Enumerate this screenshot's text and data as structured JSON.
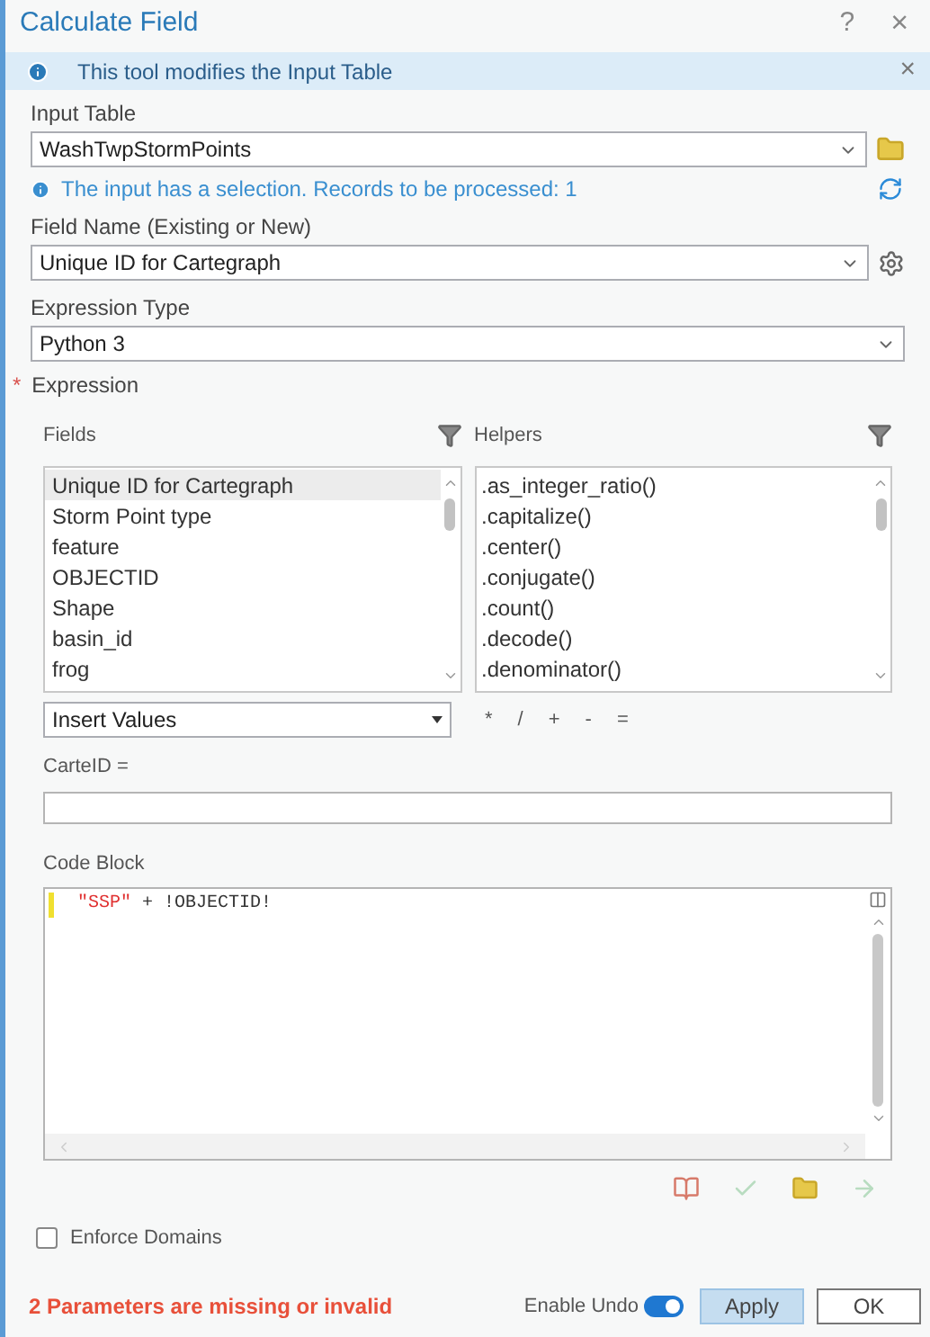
{
  "window": {
    "title": "Calculate Field",
    "help": "?",
    "close": "×"
  },
  "banner": {
    "text": "This tool modifies the Input Table",
    "close": "×"
  },
  "input_table": {
    "label": "Input Table",
    "value": "WashTwpStormPoints"
  },
  "selection_note": "The input has a selection. Records to be processed: 1",
  "field_name": {
    "label": "Field Name (Existing or New)",
    "value": "Unique ID for Cartegraph"
  },
  "expression_type": {
    "label": "Expression Type",
    "value": "Python 3"
  },
  "expression": {
    "required_mark": "*",
    "label": "Expression"
  },
  "fields": {
    "label": "Fields",
    "items": [
      {
        "text": "Unique ID for Cartegraph",
        "selected": true
      },
      {
        "text": "Storm Point type",
        "selected": false
      },
      {
        "text": "feature",
        "selected": false
      },
      {
        "text": "OBJECTID",
        "selected": false
      },
      {
        "text": "Shape",
        "selected": false
      },
      {
        "text": "basin_id",
        "selected": false
      },
      {
        "text": "frog",
        "selected": false
      }
    ]
  },
  "helpers": {
    "label": "Helpers",
    "items": [
      ".as_integer_ratio()",
      ".capitalize()",
      ".center()",
      ".conjugate()",
      ".count()",
      ".decode()",
      ".denominator()"
    ]
  },
  "insert_values": "Insert Values",
  "operators": [
    "*",
    "/",
    "+",
    "-",
    "="
  ],
  "target_label": "CarteID =",
  "code_block": {
    "label": "Code Block",
    "string": "\"SSP\"",
    "rest": " + !OBJECTID!"
  },
  "enforce_domains": {
    "label": "Enforce Domains",
    "checked": false
  },
  "footer": {
    "message": "2 Parameters are missing or invalid",
    "undo_label": "Enable Undo",
    "undo_on": true,
    "apply": "Apply",
    "ok": "OK"
  }
}
